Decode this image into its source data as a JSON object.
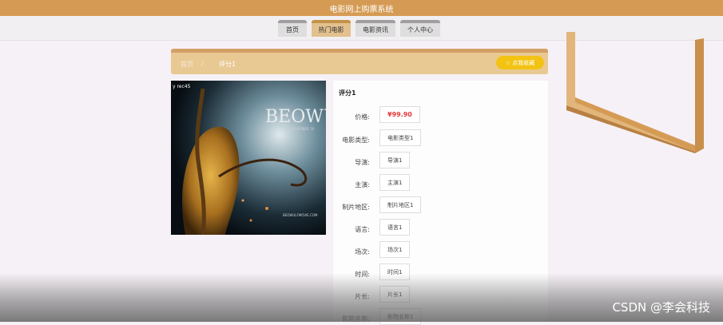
{
  "site": {
    "title": "电影网上购票系统"
  },
  "nav": {
    "tabs": [
      {
        "label": "首页",
        "active": false
      },
      {
        "label": "热门电影",
        "active": true
      },
      {
        "label": "电影资讯",
        "active": false
      },
      {
        "label": "个人中心",
        "active": false
      }
    ]
  },
  "breadcrumb": {
    "home": "首页",
    "separator": "/",
    "current": "评分1"
  },
  "favorite_button": {
    "icon": "star-icon",
    "label": "点我收藏"
  },
  "poster": {
    "corner_text": "y rec45",
    "title_text": "BEOWU",
    "subtitle_text": "NOVEMBER 16",
    "footer_text": "BEOWULFMOVIE.COM"
  },
  "details": {
    "title": "评分1",
    "rows": [
      {
        "label": "价格:",
        "value": "¥99.90"
      },
      {
        "label": "电影类型:",
        "value": "电影类型1"
      },
      {
        "label": "导演:",
        "value": "导演1"
      },
      {
        "label": "主演:",
        "value": "主演1"
      },
      {
        "label": "制片地区:",
        "value": "制片地区1"
      },
      {
        "label": "语言:",
        "value": "语言1"
      },
      {
        "label": "场次:",
        "value": "场次1"
      },
      {
        "label": "时间:",
        "value": "时间1"
      },
      {
        "label": "片长:",
        "value": "片长1"
      },
      {
        "label": "影院名称:",
        "value": "影院名称1"
      }
    ]
  },
  "watermark": "CSDN @李会科技",
  "colors": {
    "header": "#d59b54",
    "accent": "#e9c993",
    "favorite": "#f3c313",
    "price": "#e2393b"
  }
}
